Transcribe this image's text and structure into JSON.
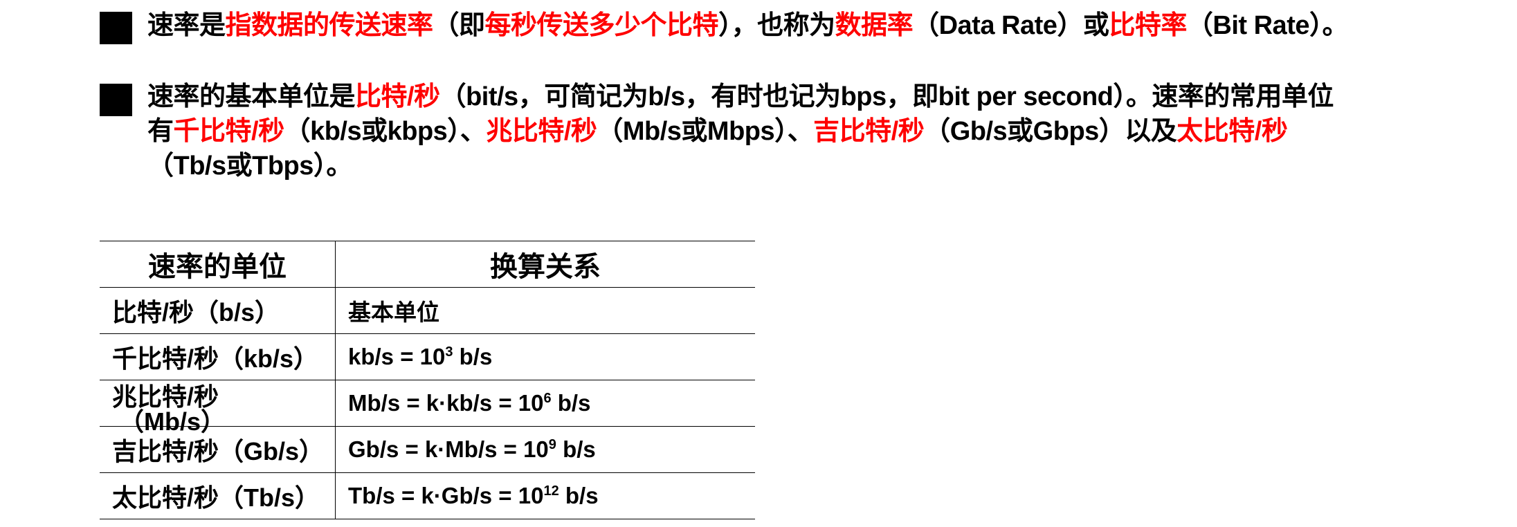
{
  "bullet1": {
    "segments": [
      {
        "text": "速率是",
        "color": "black"
      },
      {
        "text": "指数据的传送速率",
        "color": "red"
      },
      {
        "text": "（即",
        "color": "black"
      },
      {
        "text": "每秒传送多少个比特",
        "color": "red"
      },
      {
        "text": "），也称为",
        "color": "black"
      },
      {
        "text": "数据率",
        "color": "red"
      },
      {
        "text": "（Data Rate）或",
        "color": "black"
      },
      {
        "text": "比特率",
        "color": "red"
      },
      {
        "text": "（Bit Rate）。",
        "color": "black"
      }
    ]
  },
  "bullet2": {
    "line1": [
      {
        "text": "速率的基本单位是",
        "color": "black"
      },
      {
        "text": "比特/秒",
        "color": "red"
      },
      {
        "text": "（bit/s，可简记为b/s，有时也记为bps，即bit per second）。速率的常用单位",
        "color": "black"
      }
    ],
    "line2": [
      {
        "text": "有",
        "color": "black"
      },
      {
        "text": "千比特/秒",
        "color": "red"
      },
      {
        "text": "（kb/s或kbps）、",
        "color": "black"
      },
      {
        "text": "兆比特/秒",
        "color": "red"
      },
      {
        "text": "（Mb/s或Mbps）、",
        "color": "black"
      },
      {
        "text": "吉比特/秒",
        "color": "red"
      },
      {
        "text": "（Gb/s或Gbps）以及",
        "color": "black"
      },
      {
        "text": "太比特/秒",
        "color": "red"
      }
    ],
    "line3": [
      {
        "text": "（Tb/s或Tbps）。",
        "color": "black"
      }
    ]
  },
  "table": {
    "headers": [
      "速率的单位",
      "换算关系"
    ],
    "rows": [
      {
        "unit": "比特/秒（b/s）",
        "conv_pre": "基本单位",
        "conv_exp": "",
        "conv_post": ""
      },
      {
        "unit": "千比特/秒（kb/s）",
        "conv_pre": "kb/s = 10",
        "conv_exp": "3",
        "conv_post": " b/s"
      },
      {
        "unit": "兆比特/秒",
        "unit_overlap": "（Mb/s）",
        "conv_pre": "Mb/s = k·kb/s = 10",
        "conv_exp": "6",
        "conv_post": " b/s"
      },
      {
        "unit": "吉比特/秒（Gb/s）",
        "conv_pre": "Gb/s = k·Mb/s = 10",
        "conv_exp": "9",
        "conv_post": " b/s"
      },
      {
        "unit": "太比特/秒（Tb/s）",
        "conv_pre": "Tb/s = k·Gb/s = 10",
        "conv_exp": "12",
        "conv_post": " b/s"
      }
    ]
  },
  "colors": {
    "text": "#000000",
    "highlight": "#ff0000",
    "background": "#ffffff"
  }
}
